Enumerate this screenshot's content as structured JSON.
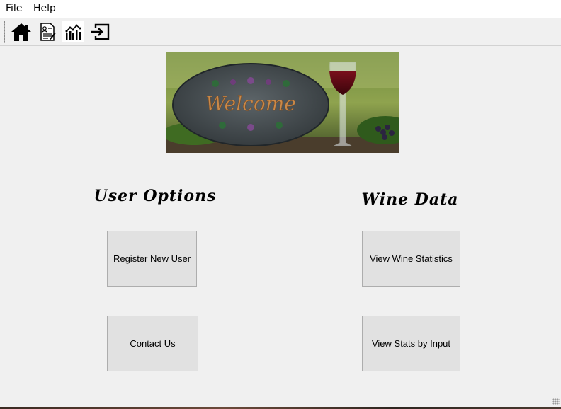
{
  "menubar": {
    "items": [
      "File",
      "Help"
    ]
  },
  "toolbar": {
    "buttons": [
      "home-icon",
      "register-form-icon",
      "statistics-chart-icon",
      "logout-icon"
    ]
  },
  "banner": {
    "text": "Welcome"
  },
  "user_options": {
    "title": "User Options",
    "register_label": "Register New User",
    "contact_label": "Contact Us"
  },
  "wine_data": {
    "title": "Wine Data",
    "statistics_label": "View Wine Statistics",
    "stats_input_label": "View Stats by Input"
  }
}
